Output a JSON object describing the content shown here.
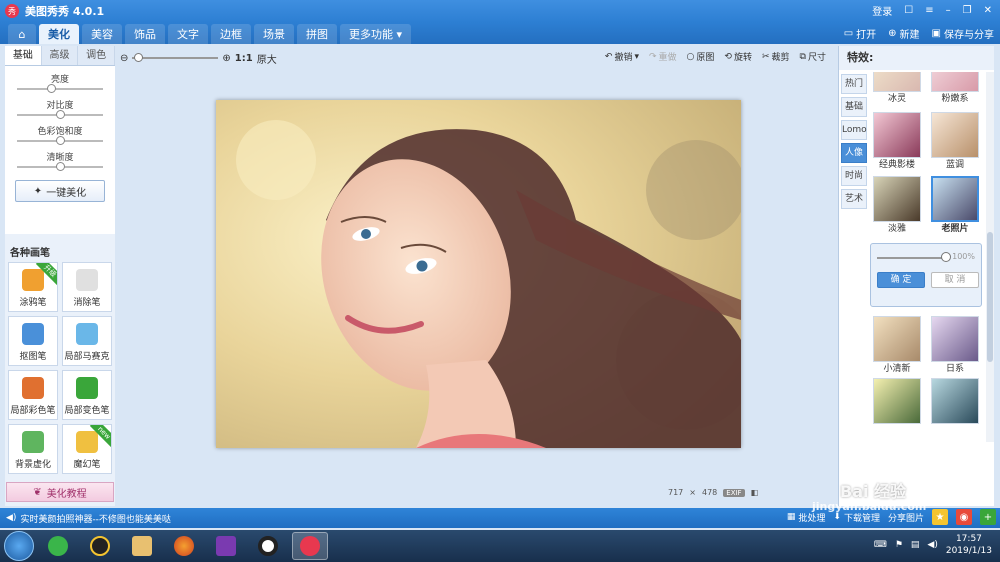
{
  "app": {
    "title": "美图秀秀 4.0.1",
    "logo_text": "秀"
  },
  "titlebar": {
    "login": "登录"
  },
  "tabs": [
    "美化",
    "美容",
    "饰品",
    "文字",
    "边框",
    "场景",
    "拼图",
    "更多功能 ▾"
  ],
  "header_actions": {
    "open": "打开",
    "new": "新建",
    "save": "保存与分享"
  },
  "left": {
    "subtabs": [
      "基础",
      "高级",
      "调色"
    ],
    "sliders": [
      {
        "label": "亮度",
        "value": 0.4
      },
      {
        "label": "对比度",
        "value": 0.5
      },
      {
        "label": "色彩饱和度",
        "value": 0.5
      },
      {
        "label": "清晰度",
        "value": 0.5
      }
    ],
    "onekey": "一键美化",
    "brushes_title": "各种画笔",
    "brushes": [
      {
        "label": "涂鸦笔",
        "color": "#f0a030",
        "badge": "升级"
      },
      {
        "label": "消除笔",
        "color": "#e0e0e0",
        "badge": ""
      },
      {
        "label": "抠图笔",
        "color": "#4a90d9",
        "badge": ""
      },
      {
        "label": "局部马赛克",
        "color": "#6ab7e8",
        "badge": ""
      },
      {
        "label": "局部彩色笔",
        "color": "#e07030",
        "badge": ""
      },
      {
        "label": "局部变色笔",
        "color": "#3aa63a",
        "badge": ""
      },
      {
        "label": "背景虚化",
        "color": "#5fb55f",
        "badge": ""
      },
      {
        "label": "魔幻笔",
        "color": "#f0c040",
        "badge": "new"
      }
    ],
    "tutorial": "美化教程"
  },
  "toolbar": {
    "ratio": "1:1",
    "original_size": "原大",
    "undo": "撤销",
    "redo": "重做",
    "original": "原图",
    "rotate": "旋转",
    "crop": "裁剪",
    "resize": "尺寸",
    "zoom": 0.02
  },
  "image_info": {
    "width": "717",
    "x": "×",
    "height": "478",
    "exif": "EXIF"
  },
  "right": {
    "title": "特效:",
    "categories": [
      "热门",
      "基础",
      "Lomo",
      "人像",
      "时尚",
      "艺术"
    ],
    "active_category": "人像",
    "effects": [
      "冰灵",
      "粉嫩系",
      "经典影楼",
      "蓝调",
      "淡雅",
      "老照片",
      "小清新",
      "日系"
    ],
    "selected": "老照片",
    "popup": {
      "percent": "100%",
      "ok": "确 定",
      "cancel": "取 消",
      "level": 1.0
    }
  },
  "status": {
    "message": "实时美颜拍照神器--不修图也能美美哒",
    "batch": "批处理",
    "download": "下载管理",
    "share": "分享图片"
  },
  "taskbar": {
    "time": "17:57",
    "date": "2019/1/13"
  },
  "watermark": {
    "brand": "Bai 经验",
    "url": "jingyan.baidu.com"
  }
}
